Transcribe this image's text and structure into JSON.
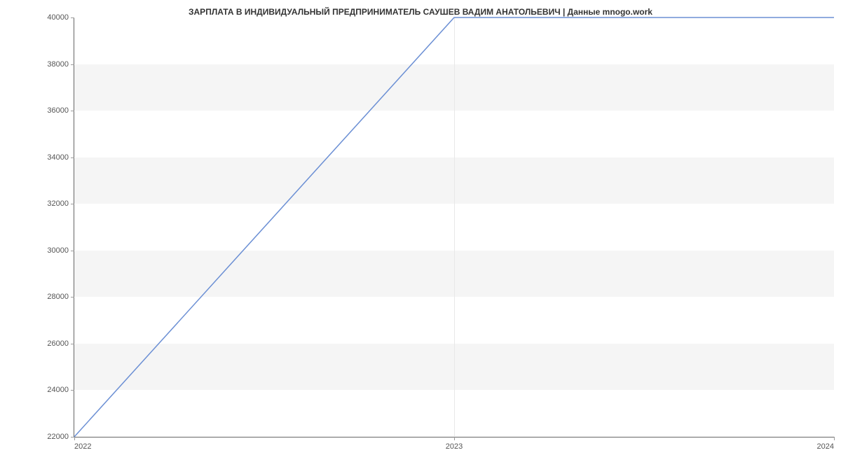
{
  "chart_data": {
    "type": "line",
    "title": "ЗАРПЛАТА В ИНДИВИДУАЛЬНЫЙ ПРЕДПРИНИМАТЕЛЬ САУШЕВ ВАДИМ АНАТОЛЬЕВИЧ | Данные mnogo.work",
    "x": [
      2022,
      2023,
      2024
    ],
    "values": [
      22000,
      40000,
      40000
    ],
    "xlabel": "",
    "ylabel": "",
    "x_ticks": [
      2022,
      2023,
      2024
    ],
    "y_ticks": [
      22000,
      24000,
      26000,
      28000,
      30000,
      32000,
      34000,
      36000,
      38000,
      40000
    ],
    "xlim": [
      2022,
      2024
    ],
    "ylim": [
      22000,
      40000
    ],
    "bands": true
  }
}
